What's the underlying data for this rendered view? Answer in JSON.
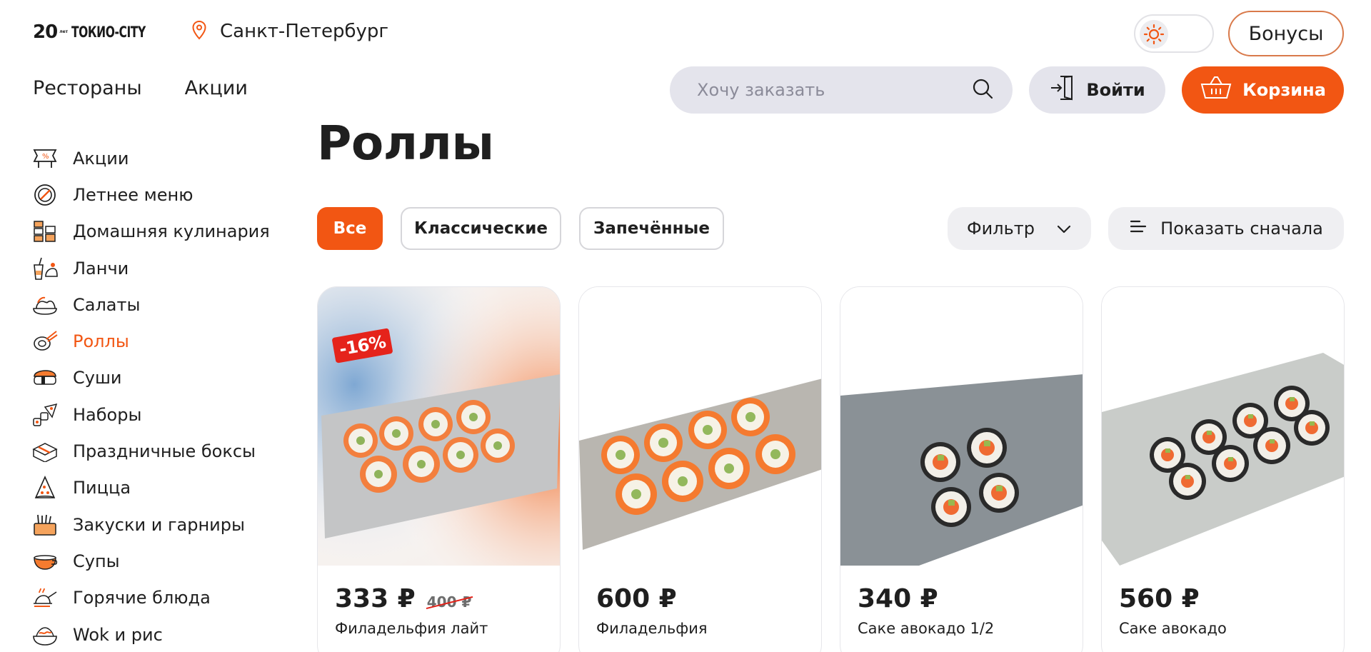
{
  "header": {
    "logo_num": "20",
    "logo_small": "лет",
    "logo_brand": "ТОКИО-CITY",
    "city": "Санкт-Петербург",
    "bonus_label": "Бонусы",
    "nav": [
      "Рестораны",
      "Акции"
    ],
    "search_placeholder": "Хочу заказать",
    "login_label": "Войти",
    "cart_label": "Корзина"
  },
  "colors": {
    "accent": "#f25613",
    "sale": "#e5231b",
    "chip_bg": "#efeff2",
    "search_bg": "#e4e4ec"
  },
  "sidebar": {
    "active": "Роллы",
    "items": [
      {
        "label": "Акции",
        "icon": "promo-icon"
      },
      {
        "label": "Летнее меню",
        "icon": "summer-menu-icon"
      },
      {
        "label": "Домашняя кулинария",
        "icon": "home-cooking-icon"
      },
      {
        "label": "Ланчи",
        "icon": "lunch-icon"
      },
      {
        "label": "Салаты",
        "icon": "salad-icon"
      },
      {
        "label": "Роллы",
        "icon": "rolls-icon"
      },
      {
        "label": "Суши",
        "icon": "sushi-icon"
      },
      {
        "label": "Наборы",
        "icon": "sets-icon"
      },
      {
        "label": "Праздничные боксы",
        "icon": "holiday-box-icon"
      },
      {
        "label": "Пицца",
        "icon": "pizza-icon"
      },
      {
        "label": "Закуски и гарниры",
        "icon": "snacks-icon"
      },
      {
        "label": "Супы",
        "icon": "soup-icon"
      },
      {
        "label": "Горячие блюда",
        "icon": "hot-dishes-icon"
      },
      {
        "label": "Wok и рис",
        "icon": "wok-icon"
      }
    ]
  },
  "main": {
    "title": "Роллы",
    "chips": [
      "Все",
      "Классические",
      "Запечённые"
    ],
    "filter_label": "Фильтр",
    "sort_label": "Показать сначала",
    "products": [
      {
        "price": "333 ₽",
        "old_price": "400 ₽",
        "name": "Филадельфия лайт",
        "badge": "-16%"
      },
      {
        "price": "600 ₽",
        "old_price": "",
        "name": "Филадельфия",
        "badge": ""
      },
      {
        "price": "340 ₽",
        "old_price": "",
        "name": "Саке авокадо 1/2",
        "badge": ""
      },
      {
        "price": "560 ₽",
        "old_price": "",
        "name": "Саке авокадо",
        "badge": ""
      }
    ]
  }
}
